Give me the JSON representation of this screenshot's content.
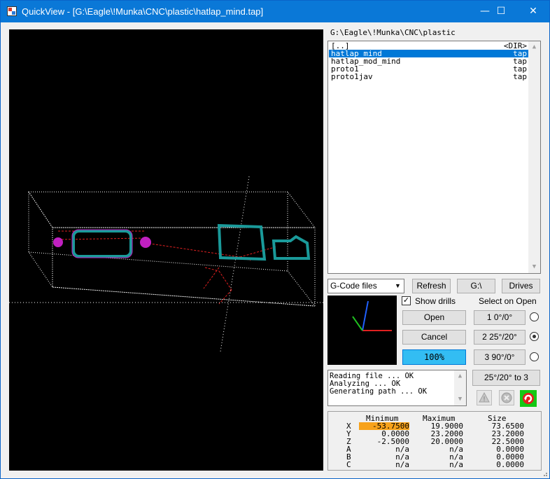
{
  "window": {
    "title": "QuickView - [G:\\Eagle\\!Munka\\CNC\\plastic\\hatlap_mind.tap]",
    "minimize_glyph": "—",
    "maximize_glyph": "☐",
    "close_glyph": "✕"
  },
  "path": "G:\\Eagle\\!Munka\\CNC\\plastic",
  "files": [
    {
      "name": "[..]",
      "ext": "<DIR>",
      "selected": false
    },
    {
      "name": "hatlap_mind",
      "ext": "tap",
      "selected": true
    },
    {
      "name": "hatlap_mod_mind",
      "ext": "tap",
      "selected": false
    },
    {
      "name": "proto1",
      "ext": "tap",
      "selected": false
    },
    {
      "name": "proto1jav",
      "ext": "tap",
      "selected": false
    }
  ],
  "controls": {
    "filter": "G-Code files",
    "refresh": "Refresh",
    "drive": "G:\\",
    "drives": "Drives",
    "show_drills": "Show drills",
    "show_drills_checked": "✓",
    "select_on_open": "Select on Open",
    "open": "Open",
    "cancel": "Cancel",
    "zoom": "100%",
    "view1": "1 0°/0°",
    "view2": "2 25°/20°",
    "view3": "3 90°/0°",
    "view_to": "25°/20° to 3",
    "selected_view": 2
  },
  "log": [
    "Reading file ... OK",
    "Analyzing ... OK",
    "Generating path ... OK"
  ],
  "limits": {
    "headers": [
      "Minimum",
      "Maximum",
      "Size"
    ],
    "rows": [
      {
        "axis": "X",
        "min": "-53.7500",
        "max": "19.9000",
        "size": "73.6500"
      },
      {
        "axis": "Y",
        "min": "0.0000",
        "max": "23.2000",
        "size": "23.2000"
      },
      {
        "axis": "Z",
        "min": "-2.5000",
        "max": "20.0000",
        "size": "22.5000"
      },
      {
        "axis": "A",
        "min": "n/a",
        "max": "n/a",
        "size": "0.0000"
      },
      {
        "axis": "B",
        "min": "n/a",
        "max": "n/a",
        "size": "0.0000"
      },
      {
        "axis": "C",
        "min": "n/a",
        "max": "n/a",
        "size": "0.0000"
      }
    ]
  },
  "colors": {
    "titlebar": "#0a78d7",
    "toolpath": "#1a9a9a",
    "drill": "#c020c0",
    "rapid": "#e02020",
    "highlight": "#f7a21b"
  }
}
